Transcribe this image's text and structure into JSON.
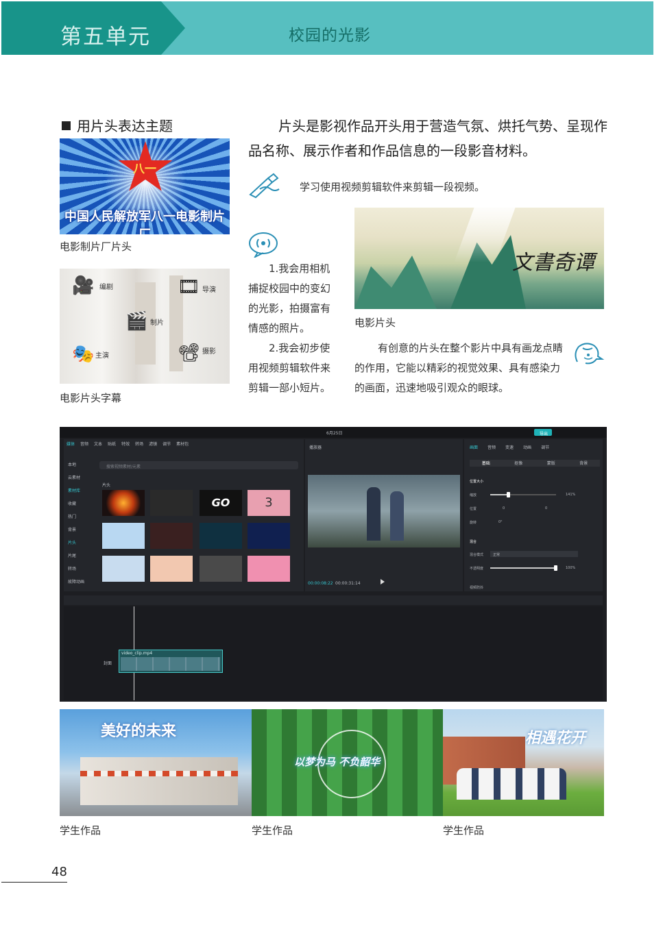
{
  "header": {
    "unit": "第五单元",
    "chapter": "校园的光影"
  },
  "section": {
    "title": "用片头表达主题"
  },
  "intro": "片头是影视作品开头用于营造气氛、烘托气势、呈现作品名称、展示作者和作品信息的一段影音材料。",
  "task": "学习使用视频剪辑软件来剪辑一段视频。",
  "images": {
    "bayi": {
      "banner": "中国人民解放军八一电影制片厂",
      "star": "八一",
      "caption": "电影制片厂片头"
    },
    "subtitles": {
      "caption": "电影片头字幕",
      "labels": [
        "编剧",
        "导演",
        "制片",
        "主演",
        "摄影"
      ]
    },
    "guochao": {
      "title": "文書奇谭",
      "caption": "电影片头"
    }
  },
  "goals": [
    "1.我会用相机捕捉校园中的变幻的光影，拍摄富有情感的照片。",
    "2.我会初步使用视频剪辑软件来剪辑一部小短片。"
  ],
  "note": "有创意的片头在整个影片中具有画龙点睛的作用，它能以精彩的视觉效果、具有感染力的画面，迅速地吸引观众的眼球。",
  "editor": {
    "top_center": "6月25日",
    "toolbar": [
      "媒体",
      "音频",
      "文本",
      "贴纸",
      "特效",
      "转场",
      "滤镜",
      "调节",
      "素材包"
    ],
    "side_menu": [
      "本地",
      "云素材",
      "素材库",
      "收藏",
      "热门",
      "背景",
      "片头",
      "片尾",
      "转场",
      "故障动画"
    ],
    "search_placeholder": "搜索视频素材/元素",
    "group_label": "片头",
    "player_label": "播放器",
    "time_current": "00:00:08:22",
    "time_total": "00:00:31:14",
    "export_label": "导出",
    "props_tabs": [
      "画面",
      "音频",
      "变速",
      "动画",
      "调节"
    ],
    "props_subtabs": [
      "基础",
      "抠像",
      "蒙版",
      "背景"
    ],
    "props": {
      "position_size": "位置大小",
      "scale_label": "缩放",
      "scale_value": "141%",
      "pos_label": "位置",
      "pos_x": "0",
      "pos_y": "0",
      "rotate_label": "旋转",
      "rotate_value": "0°",
      "blend_label": "混合",
      "blend_mode_label": "混合模式",
      "blend_mode_value": "正常",
      "opacity_label": "不透明度",
      "opacity_value": "100%",
      "stabilize": "视频防抖"
    },
    "clip_name": "video_clip.mp4",
    "cover_label": "封面",
    "thumb_go": "GO",
    "thumb_num": "3"
  },
  "works": {
    "w1_title": "美好的未来",
    "w2_title": "以梦为马 不负韶华",
    "w3_title": "相遇花开",
    "caption": "学生作品"
  },
  "page_number": "48",
  "colors": {
    "header_light": "#57bfc0",
    "header_dark": "#18948a",
    "icon_teal": "#2a8fb5"
  }
}
